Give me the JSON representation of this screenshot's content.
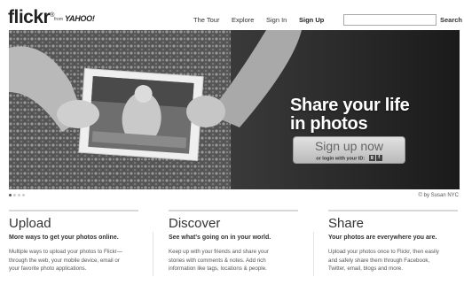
{
  "header": {
    "logo": "flickr",
    "logo_from": "from",
    "logo_yahoo": "YAHOO!",
    "nav": [
      "The Tour",
      "Explore",
      "Sign In",
      "Sign Up"
    ],
    "search_value": "",
    "search_button": "Search"
  },
  "hero": {
    "title_line1": "Share your life",
    "title_line2": "in photos",
    "cta_label": "Sign up now",
    "cta_sub": "or login with your ID:",
    "slides": 4,
    "active_slide": 1,
    "credit": "© by Susan NYC"
  },
  "columns": [
    {
      "title": "Upload",
      "subtitle": "More ways to get your photos online.",
      "body_lines": [
        "Multiple ways to upload your photos to Flickr—",
        "through the web, your mobile device, email or",
        "your favorite photo applications."
      ]
    },
    {
      "title": "Discover",
      "subtitle": "See what's going on in your world.",
      "body_lines": [
        "Keep up with your friends and share your",
        "stories with comments & notes. Add rich",
        "information like tags, locations & people."
      ]
    },
    {
      "title": "Share",
      "subtitle": "Your photos are everywhere you are.",
      "body_lines": [
        "Upload your photos once to Flickr, then easily",
        "and safely share them through Facebook,",
        "Twitter, email, blogs and more."
      ]
    }
  ]
}
